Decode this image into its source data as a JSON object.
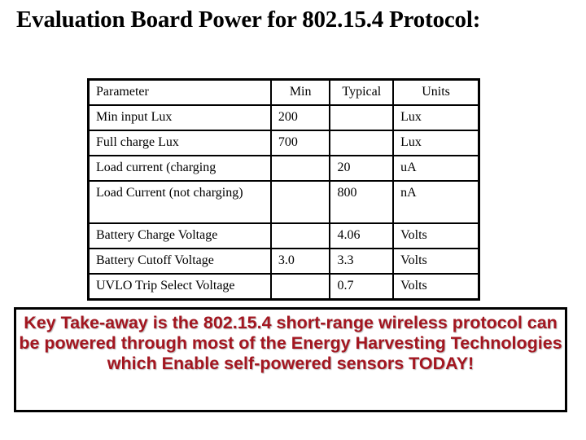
{
  "title": "Evaluation Board Power for 802.15.4 Protocol:",
  "table": {
    "headers": [
      "Parameter",
      "Min",
      "Typical",
      "Units"
    ],
    "rows": [
      {
        "parameter": "Min input Lux",
        "min": "200",
        "typical": "",
        "units": "Lux"
      },
      {
        "parameter": "Full charge Lux",
        "min": "700",
        "typical": "",
        "units": "Lux"
      },
      {
        "parameter": "Load current (charging",
        "min": "",
        "typical": "20",
        "units": "uA"
      },
      {
        "parameter": "Load Current (not charging)",
        "min": "",
        "typical": "800",
        "units": "nA"
      },
      {
        "parameter": "Battery Charge Voltage",
        "min": "",
        "typical": "4.06",
        "units": "Volts"
      },
      {
        "parameter": "Battery Cutoff Voltage",
        "min": "3.0",
        "typical": "3.3",
        "units": "Volts"
      },
      {
        "parameter": "UVLO Trip Select Voltage",
        "min": "",
        "typical": "0.7",
        "units": "Volts"
      }
    ]
  },
  "takeaway": {
    "text": "Key Take-away is the 802.15.4 short-range wireless protocol can be powered through most of the Energy Harvesting Technologies which Enable self-powered sensors TODAY!",
    "color": "#a31620"
  }
}
